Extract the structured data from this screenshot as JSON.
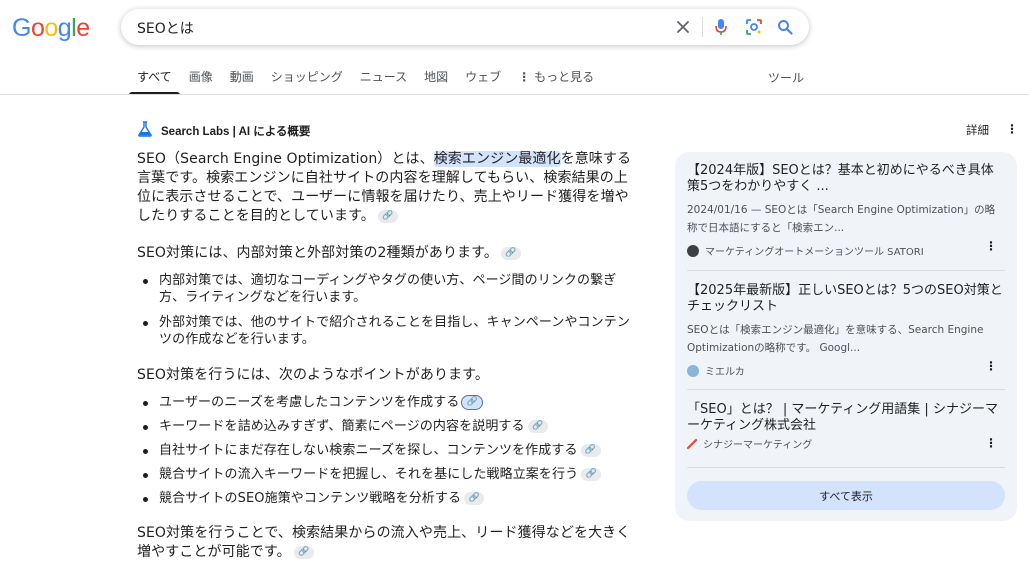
{
  "header": {
    "logo_letters": [
      "G",
      "o",
      "o",
      "g",
      "l",
      "e"
    ],
    "logo_colors": [
      "#4285F4",
      "#EA4335",
      "#FBBC05",
      "#4285F4",
      "#34A853",
      "#EA4335"
    ],
    "search_query": "SEOとは"
  },
  "tabs": [
    {
      "label": "すべて",
      "active": true
    },
    {
      "label": "画像"
    },
    {
      "label": "動画"
    },
    {
      "label": "ショッピング"
    },
    {
      "label": "ニュース"
    },
    {
      "label": "地図"
    },
    {
      "label": "ウェブ"
    },
    {
      "label": "もっと見る"
    }
  ],
  "tools_label": "ツール",
  "ai_overview": {
    "title": "Search Labs | AI による概要",
    "detail_label": "詳細",
    "para1_before": "SEO（Search Engine Optimization）とは、",
    "para1_highlight": "検索エンジン最適化",
    "para1_after": "を意味する言葉です。検索エンジンに自社サイトの内容を理解してもらい、検索結果の上位に表示させることで、ユーザーに情報を届けたり、売上やリード獲得を増やしたりすることを目的としています。",
    "para2": "SEO対策には、内部対策と外部対策の2種類があります。",
    "bullets1": [
      "内部対策では、適切なコーディングやタグの使い方、ページ間のリンクの繋ぎ方、ライティングなどを行います。",
      "外部対策では、他のサイトで紹介されることを目指し、キャンペーンやコンテンツの作成などを行います。"
    ],
    "para3": "SEO対策を行うには、次のようなポイントがあります。",
    "bullets2": [
      "ユーザーのニーズを考慮したコンテンツを作成する",
      "キーワードを詰め込みすぎず、簡素にページの内容を説明する",
      "自社サイトにまだ存在しない検索ニーズを探し、コンテンツを作成する",
      "競合サイトの流入キーワードを把握し、それを基にした戦略立案を行う",
      "競合サイトのSEO施策やコンテンツ戦略を分析する"
    ],
    "para4": "SEO対策を行うことで、検索結果からの流入や売上、リード獲得などを大きく増やすことが可能です。"
  },
  "sources": [
    {
      "title": "【2024年版】SEOとは？基本と初めにやるべき具体策5つをわかりやすく ...",
      "snippet": "2024/01/16 — SEOとは「Search Engine Optimization」の略称で日本語にすると「検索エン...",
      "site": "マーケティングオートメーションツール SATORI",
      "icon_color": "#3c4043"
    },
    {
      "title": "【2025年最新版】正しいSEOとは？5つのSEO対策とチェックリスト",
      "snippet": "SEOとは「検索エンジン最適化」を意味する、Search Engine Optimizationの略称です。 Googl...",
      "site": "ミエルカ",
      "icon_color": "#8ab4d8"
    },
    {
      "title": "「SEO」とは？ | マーケティング用語集 | シナジーマーケティング株式会社",
      "snippet": "",
      "site": "シナジーマーケティング",
      "icon_color": "#e8453c"
    }
  ],
  "show_all_label": "すべて表示"
}
